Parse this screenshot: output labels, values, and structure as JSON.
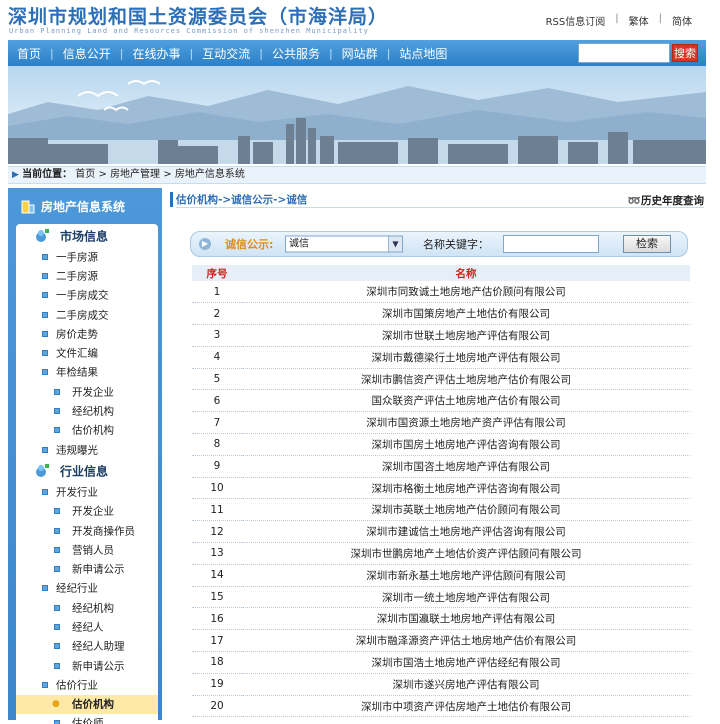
{
  "header": {
    "title": "深圳市规划和国土资源委员会（市海洋局）",
    "subtitle": "Urban Planning Land and Resources Commission of shenzhen Municipality",
    "top_links": [
      "RSS信息订阅",
      "繁体",
      "简体"
    ]
  },
  "nav": {
    "items": [
      "首页",
      "信息公开",
      "在线办事",
      "互动交流",
      "公共服务",
      "网站群",
      "站点地图"
    ],
    "search_button": "搜索"
  },
  "breadcrumb": {
    "label": "当前位置：",
    "items": [
      "首页",
      "房地产管理",
      "房地产信息系统"
    ],
    "separator": ">"
  },
  "sidebar": {
    "title": "房地产信息系统",
    "rows": [
      {
        "label": "市场信息",
        "type": "group",
        "level": 0
      },
      {
        "label": "一手房源",
        "type": "item",
        "level": 1
      },
      {
        "label": "二手房源",
        "type": "item",
        "level": 1
      },
      {
        "label": "一手房成交",
        "type": "item",
        "level": 1
      },
      {
        "label": "二手房成交",
        "type": "item",
        "level": 1
      },
      {
        "label": "房价走势",
        "type": "item",
        "level": 1
      },
      {
        "label": "文件汇编",
        "type": "item",
        "level": 1
      },
      {
        "label": "年检结果",
        "type": "item",
        "level": 1
      },
      {
        "label": "开发企业",
        "type": "item",
        "level": 2
      },
      {
        "label": "经纪机构",
        "type": "item",
        "level": 2
      },
      {
        "label": "估价机构",
        "type": "item",
        "level": 2
      },
      {
        "label": "违规曝光",
        "type": "item",
        "level": 1
      },
      {
        "label": "行业信息",
        "type": "group",
        "level": 0
      },
      {
        "label": "开发行业",
        "type": "item",
        "level": 1
      },
      {
        "label": "开发企业",
        "type": "item",
        "level": 2
      },
      {
        "label": "开发商操作员",
        "type": "item",
        "level": 2
      },
      {
        "label": "营销人员",
        "type": "item",
        "level": 2
      },
      {
        "label": "新申请公示",
        "type": "item",
        "level": 2
      },
      {
        "label": "经纪行业",
        "type": "item",
        "level": 1
      },
      {
        "label": "经纪机构",
        "type": "item",
        "level": 2
      },
      {
        "label": "经纪人",
        "type": "item",
        "level": 2
      },
      {
        "label": "经纪人助理",
        "type": "item",
        "level": 2
      },
      {
        "label": "新申请公示",
        "type": "item",
        "level": 2
      },
      {
        "label": "估价行业",
        "type": "item",
        "level": 1
      },
      {
        "label": "估价机构",
        "type": "item",
        "level": 2,
        "active": true
      },
      {
        "label": "估价师",
        "type": "item",
        "level": 2
      }
    ]
  },
  "main": {
    "title": "估价机构->诚信公示->诚信",
    "history_link": "历史年度查询",
    "filter": {
      "label": "诚信公示:",
      "select_value": "诚信",
      "keyword_label": "名称关键字：",
      "keyword_value": "",
      "search_button": "检索"
    },
    "table": {
      "headers": [
        "序号",
        "名称"
      ],
      "rows": [
        [
          "1",
          "深圳市同致诚土地房地产估价顾问有限公司"
        ],
        [
          "2",
          "深圳市国策房地产土地估价有限公司"
        ],
        [
          "3",
          "深圳市世联土地房地产评估有限公司"
        ],
        [
          "4",
          "深圳市戴德梁行土地房地产评估有限公司"
        ],
        [
          "5",
          "深圳市鹏信资产评估土地房地产估价有限公司"
        ],
        [
          "6",
          "国众联资产评估土地房地产估价有限公司"
        ],
        [
          "7",
          "深圳市国资源土地房地产资产评估有限公司"
        ],
        [
          "8",
          "深圳市国房土地房地产评估咨询有限公司"
        ],
        [
          "9",
          "深圳市国咨土地房地产评估有限公司"
        ],
        [
          "10",
          "深圳市格衡土地房地产评估咨询有限公司"
        ],
        [
          "11",
          "深圳市英联土地房地产估价顾问有限公司"
        ],
        [
          "12",
          "深圳市建诚信土地房地产评估咨询有限公司"
        ],
        [
          "13",
          "深圳市世鹏房地产土地估价资产评估顾问有限公司"
        ],
        [
          "14",
          "深圳市新永基土地房地产评估顾问有限公司"
        ],
        [
          "15",
          "深圳市一统土地房地产评估有限公司"
        ],
        [
          "16",
          "深圳市国瀛联土地房地产评估有限公司"
        ],
        [
          "17",
          "深圳市融泽源资产评估土地房地产估价有限公司"
        ],
        [
          "18",
          "深圳市国浩土地房地产评估经纪有限公司"
        ],
        [
          "19",
          "深圳市遂兴房地产评估有限公司"
        ],
        [
          "20",
          "深圳市中项资产评估房地产土地估价有限公司"
        ]
      ]
    }
  },
  "colors": {
    "nav_blue": "#2d7fc7",
    "title_blue": "#2d6fb7",
    "header_red": "#c8281f",
    "filter_orange": "#e08a1b"
  }
}
